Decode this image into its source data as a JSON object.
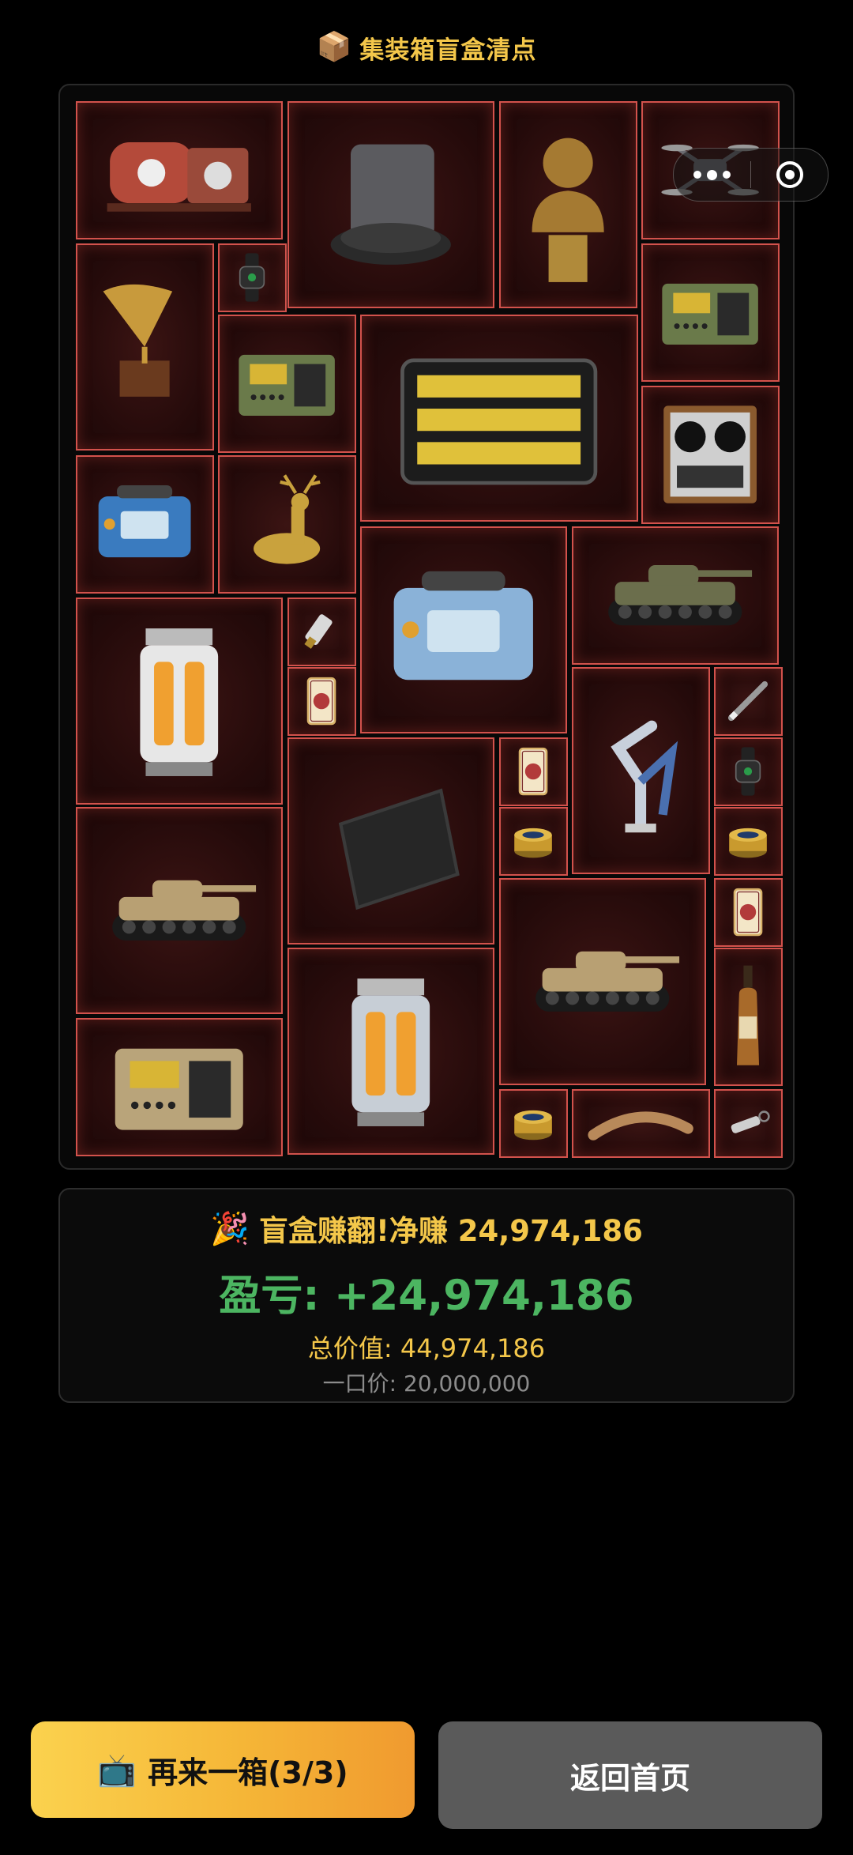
{
  "header": {
    "icon": "package-box-icon",
    "title": "集装箱盲盒清点"
  },
  "capsule": {
    "more_icon": "more-dots-icon",
    "close_icon": "target-ring-icon"
  },
  "container": {
    "items": [
      {
        "name": "vintage-steampunk-machine",
        "icon": "steampunk-device-icon"
      },
      {
        "name": "robot-vacuum-station",
        "icon": "robot-vacuum-icon"
      },
      {
        "name": "cato-bronze-bust",
        "icon": "bust-icon"
      },
      {
        "name": "drone",
        "icon": "drone-icon"
      },
      {
        "name": "gramophone",
        "icon": "gramophone-icon"
      },
      {
        "name": "smart-watch",
        "icon": "watch-icon"
      },
      {
        "name": "military-radio",
        "icon": "radio-icon"
      },
      {
        "name": "battery-pack",
        "icon": "battery-icon"
      },
      {
        "name": "military-radio",
        "icon": "radio-icon"
      },
      {
        "name": "reel-to-reel-tape-recorder",
        "icon": "tape-recorder-icon"
      },
      {
        "name": "blue-generator",
        "icon": "generator-icon"
      },
      {
        "name": "golden-deer-statue",
        "icon": "deer-icon"
      },
      {
        "name": "medical-device",
        "icon": "medical-device-icon"
      },
      {
        "name": "armored-vehicle",
        "icon": "armored-vehicle-icon"
      },
      {
        "name": "energy-core-canister",
        "icon": "energy-core-icon"
      },
      {
        "name": "usb-drive",
        "icon": "usb-icon"
      },
      {
        "name": "playing-card",
        "icon": "card-icon"
      },
      {
        "name": "robotic-arm",
        "icon": "robotic-arm-icon"
      },
      {
        "name": "pen",
        "icon": "pen-icon"
      },
      {
        "name": "carbon-fiber-plate",
        "icon": "plate-icon"
      },
      {
        "name": "playing-card",
        "icon": "card-icon"
      },
      {
        "name": "smart-watch",
        "icon": "watch-icon"
      },
      {
        "name": "caviar-tin",
        "icon": "tin-icon"
      },
      {
        "name": "caviar-tin",
        "icon": "tin-icon"
      },
      {
        "name": "main-battle-tank",
        "icon": "tank-icon"
      },
      {
        "name": "main-battle-tank",
        "icon": "tank-icon"
      },
      {
        "name": "playing-card",
        "icon": "card-icon"
      },
      {
        "name": "whisky-bottle",
        "icon": "bottle-icon"
      },
      {
        "name": "field-computer-case",
        "icon": "computer-case-icon"
      },
      {
        "name": "hazard-reactor-canister",
        "icon": "reactor-icon"
      },
      {
        "name": "caviar-tin",
        "icon": "tin-icon"
      },
      {
        "name": "ivory-horn",
        "icon": "horn-icon"
      },
      {
        "name": "flashlight",
        "icon": "flashlight-icon"
      }
    ]
  },
  "result": {
    "icon": "party-popper-icon",
    "headline": "盲盒赚翻!净赚 24,974,186",
    "profit_label": "盈亏: +24,974,186",
    "total_value": "总价值: 44,974,186",
    "price": "一口价: 20,000,000"
  },
  "buttons": {
    "again_icon": "tv-icon",
    "again_label": "再来一箱(3/3)",
    "home_label": "返回首页"
  },
  "colors": {
    "accent_gold": "#f4c74a",
    "profit_green": "#4cb561",
    "cell_border": "#d2524c",
    "button_gradient_start": "#fbd24e",
    "button_gradient_end": "#f09a2f",
    "home_button": "#5a5a5a"
  }
}
